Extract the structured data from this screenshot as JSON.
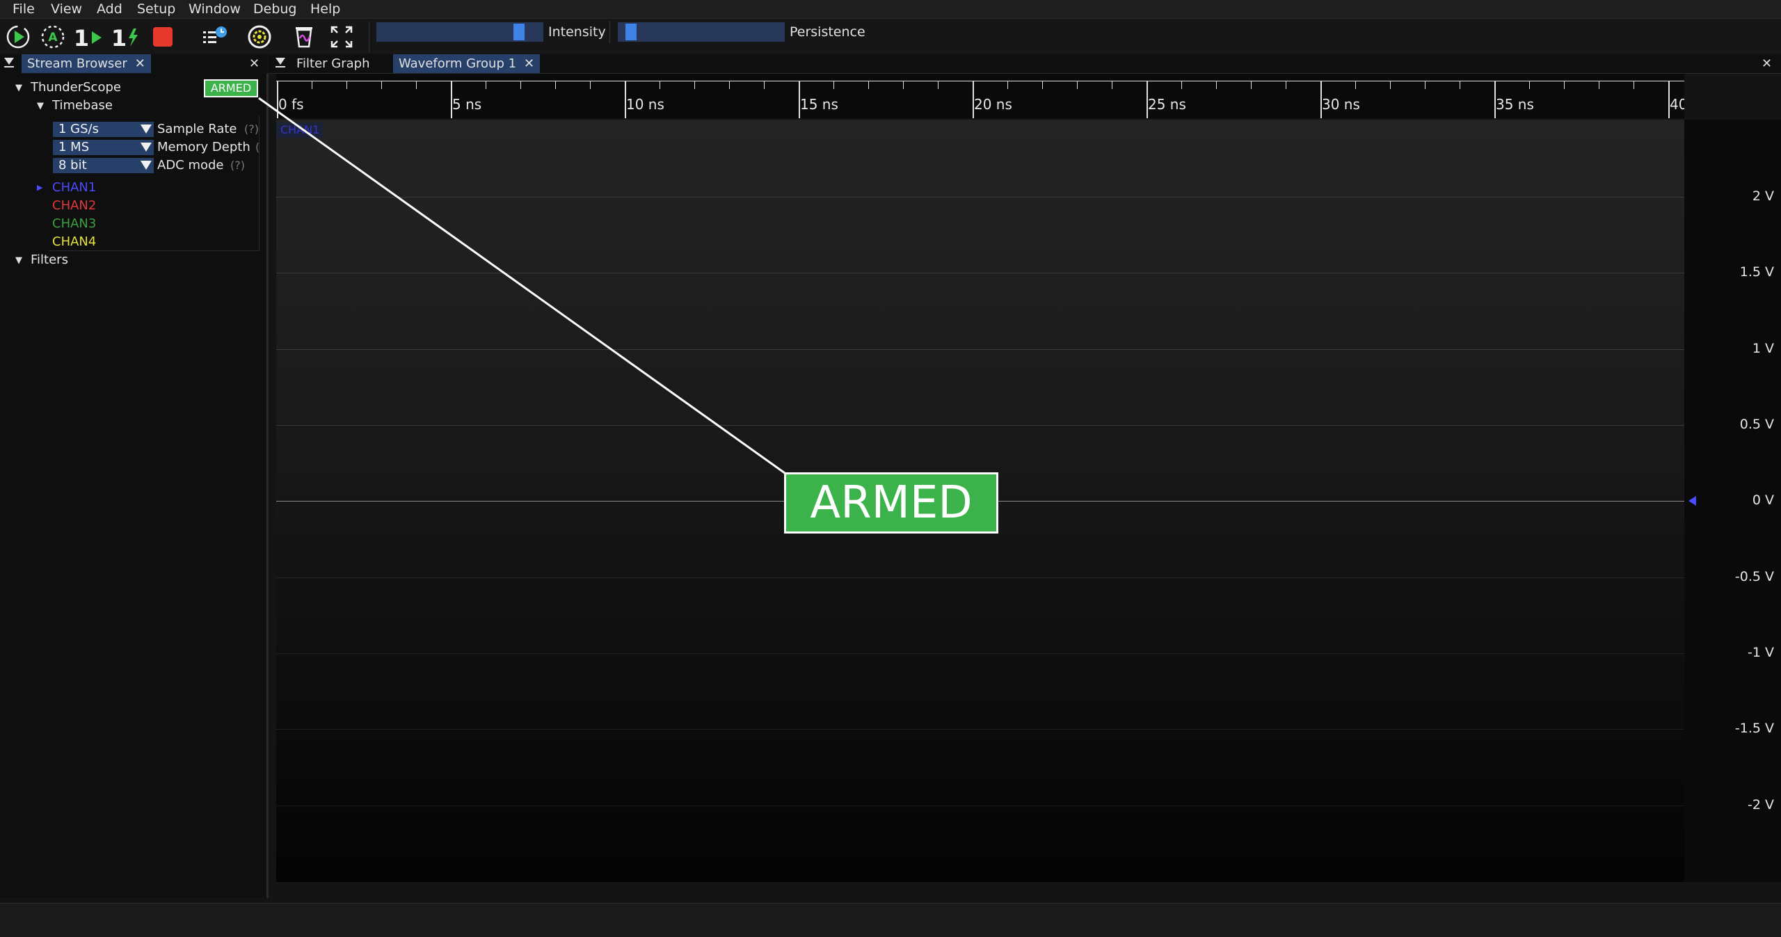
{
  "menu": [
    "File",
    "View",
    "Add",
    "Setup",
    "Window",
    "Debug",
    "Help"
  ],
  "toolbar": {
    "intensity_label": "Intensity",
    "persistence_label": "Persistence",
    "intensity_level": 0.88,
    "persistence_level": 0.05
  },
  "left_tabs": {
    "stream_browser": "Stream Browser"
  },
  "right_tabs": {
    "filter_graph": "Filter Graph",
    "waveform_group": "Waveform Group 1"
  },
  "tree": {
    "instrument": "ThunderScope",
    "armed_badge": "ARMED",
    "timebase": "Timebase",
    "params": [
      {
        "value": "1 GS/s",
        "label": "Sample Rate",
        "help": "(?)"
      },
      {
        "value": "1 MS",
        "label": "Memory Depth",
        "help": "("
      },
      {
        "value": "8 bit",
        "label": "ADC mode",
        "help": "(?)"
      }
    ],
    "channels": [
      "CHAN1",
      "CHAN2",
      "CHAN3",
      "CHAN4"
    ],
    "filters": "Filters"
  },
  "plot": {
    "time_ticks": [
      "0 fs",
      "5 ns",
      "10 ns",
      "15 ns",
      "20 ns",
      "25 ns",
      "30 ns",
      "35 ns",
      "40"
    ],
    "volt_ticks": [
      "2 V",
      "1.5 V",
      "1 V",
      "0.5 V",
      "0 V",
      "-0.5 V",
      "-1 V",
      "-1.5 V",
      "-2 V"
    ],
    "channel_label": "CHAN1",
    "armed_overlay": "ARMED"
  },
  "colors": {
    "accent": "#27406a",
    "armed_green": "#3cb34a",
    "chan1": "#4b4bff",
    "chan2": "#e0393b",
    "chan3": "#3aa040",
    "chan4": "#e8e13a",
    "stop_red": "#e8392e"
  }
}
